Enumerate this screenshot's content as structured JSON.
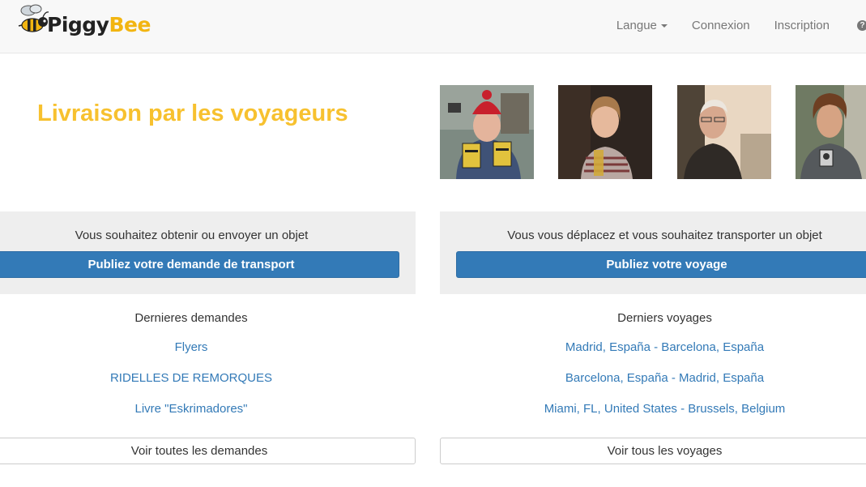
{
  "navbar": {
    "logo": {
      "part1": "Piggy",
      "part2": "Bee"
    },
    "links": {
      "language": "Langue",
      "login": "Connexion",
      "signup": "Inscription"
    },
    "help_icon_glyph": "?"
  },
  "hero": {
    "title": "Livraison par les voyageurs",
    "photos": [
      "traveler-man-red-hat",
      "traveler-woman-drink",
      "traveler-older-man",
      "traveler-young-man-camera"
    ]
  },
  "senders": {
    "prompt": "Vous souhaitez obtenir ou envoyer un objet",
    "cta": "Publiez votre demande de transport",
    "list_title": "Dernieres demandes",
    "items": [
      "Flyers",
      "RIDELLES DE REMORQUES",
      "Livre \"Eskrimadores\""
    ],
    "see_all": "Voir toutes les demandes"
  },
  "travelers": {
    "prompt": "Vous vous déplacez et vous souhaitez transporter un objet",
    "cta": "Publiez votre voyage",
    "list_title": "Derniers voyages",
    "items": [
      "Madrid, España - Barcelona, España",
      "Barcelona, España - Madrid, España",
      "Miami, FL, United States - Brussels, Belgium"
    ],
    "see_all": "Voir tous les voyages"
  },
  "colors": {
    "brand_yellow": "#f7c12f",
    "primary_blue": "#337ab7",
    "panel_gray": "#eeeeee",
    "navbar_bg": "#f8f8f8"
  }
}
